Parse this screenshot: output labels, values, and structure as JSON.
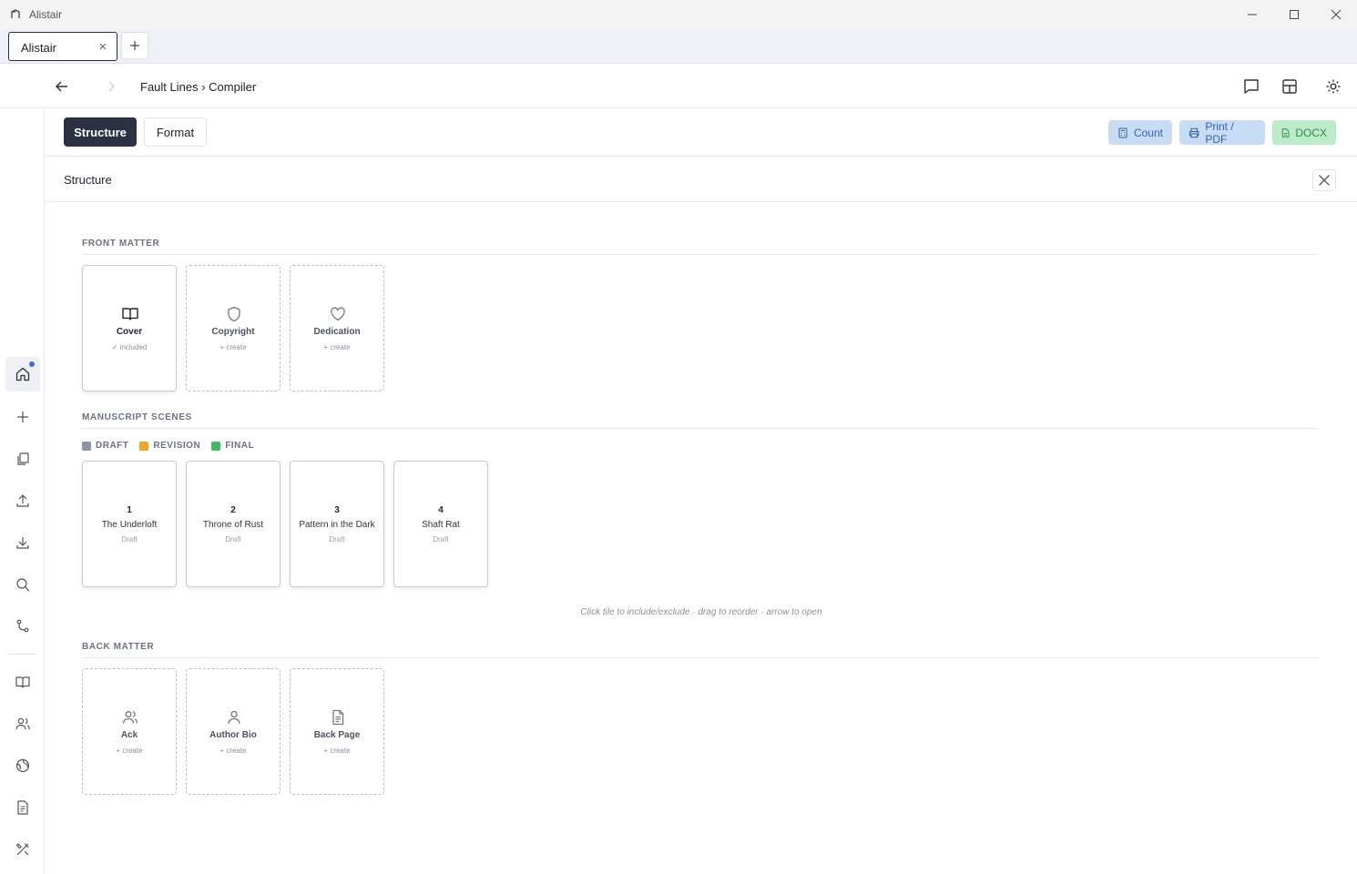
{
  "window": {
    "title": "Alistair"
  },
  "tabs": [
    {
      "label": "Alistair",
      "close": "×"
    }
  ],
  "new_tab": "+",
  "header": {
    "breadcrumb": "Fault Lines › Compiler"
  },
  "toolbar": {
    "modes": [
      {
        "label": "Structure",
        "active": true
      },
      {
        "label": "Format",
        "active": false
      }
    ],
    "count_label": "Count",
    "print_label": "Print / PDF",
    "docx_label": "DOCX"
  },
  "panel": {
    "title": "Structure"
  },
  "front_matter": {
    "label": "FRONT MATTER",
    "tiles": [
      {
        "name": "Cover",
        "sub": "✓ included",
        "icon": "book-open-icon",
        "included": true
      },
      {
        "name": "Copyright",
        "sub": "+ create",
        "icon": "shield-icon",
        "included": false
      },
      {
        "name": "Dedication",
        "sub": "+ create",
        "icon": "heart-icon",
        "included": false
      }
    ]
  },
  "manuscript": {
    "label": "MANUSCRIPT SCENES",
    "legend": [
      {
        "label": "DRAFT",
        "color": "#8b95a5"
      },
      {
        "label": "REVISION",
        "color": "#f2a623"
      },
      {
        "label": "FINAL",
        "color": "#3fba6a"
      }
    ],
    "scenes": [
      {
        "num": "1",
        "title": "The Underloft",
        "status": "Draft"
      },
      {
        "num": "2",
        "title": "Throne of Rust",
        "status": "Draft"
      },
      {
        "num": "3",
        "title": "Pattern in the Dark",
        "status": "Draft"
      },
      {
        "num": "4",
        "title": "Shaft Rat",
        "status": "Draft"
      }
    ],
    "hint": "Click tile to include/exclude · drag to reorder · arrow to open"
  },
  "back_matter": {
    "label": "BACK MATTER",
    "tiles": [
      {
        "name": "Ack",
        "sub": "+ create",
        "icon": "users-icon",
        "included": false
      },
      {
        "name": "Author Bio",
        "sub": "+ create",
        "icon": "user-icon",
        "included": false
      },
      {
        "name": "Back Page",
        "sub": "+ create",
        "icon": "file-text-icon",
        "included": false
      }
    ]
  },
  "colors": {
    "accent_dark": "#2b3140",
    "blue_btn": "#c9dcf5",
    "green_btn": "#bdeccb",
    "notification": "#3b6fd8"
  }
}
